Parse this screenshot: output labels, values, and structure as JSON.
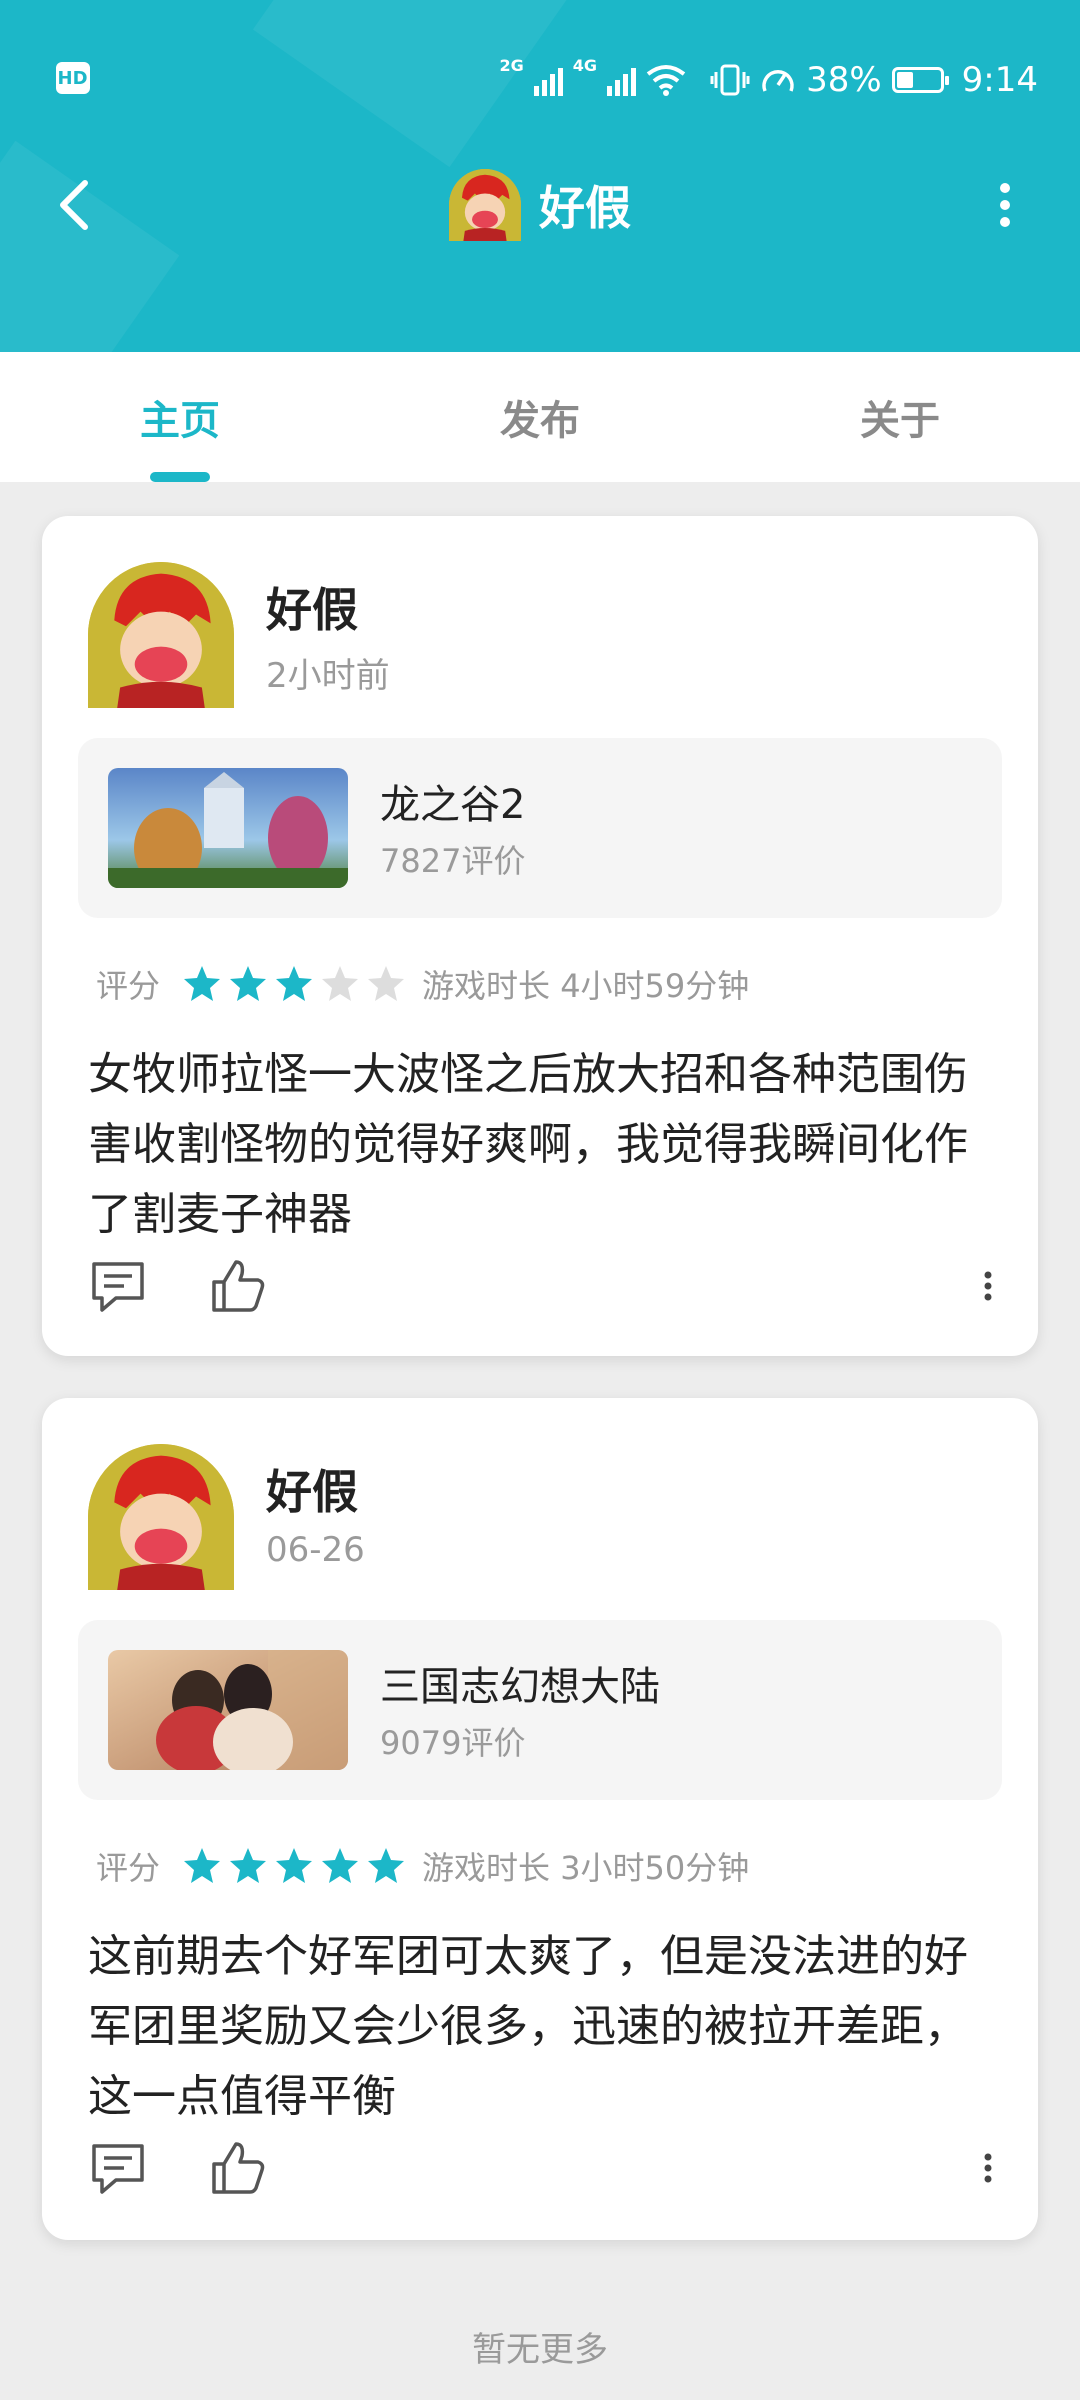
{
  "status_bar": {
    "hd": "HD",
    "net1": "2G",
    "net2": "4G",
    "battery_percent": "38%",
    "battery_level": 0.38,
    "time": "9:14"
  },
  "nav": {
    "title": "好假"
  },
  "tabs": [
    {
      "label": "主页",
      "active": true
    },
    {
      "label": "发布",
      "active": false
    },
    {
      "label": "关于",
      "active": false
    }
  ],
  "posts": [
    {
      "user": "好假",
      "time": "2小时前",
      "game": {
        "name": "龙之谷2",
        "reviews": "7827评价"
      },
      "rating_label": "评分",
      "stars": 3,
      "playtime": "游戏时长 4小时59分钟",
      "review": "女牧师拉怪一大波怪之后放大招和各种范围伤害收割怪物的觉得好爽啊，我觉得我瞬间化作了割麦子神器"
    },
    {
      "user": "好假",
      "time": "06-26",
      "game": {
        "name": "三国志幻想大陆",
        "reviews": "9079评价"
      },
      "rating_label": "评分",
      "stars": 5,
      "playtime": "游戏时长 3小时50分钟",
      "review": "这前期去个好军团可太爽了，但是没法进的好军团里奖励又会少很多，迅速的被拉开差距，这一点值得平衡"
    }
  ],
  "footer": "暂无更多",
  "colors": {
    "accent": "#1cb7c8",
    "star_empty": "#dddddd"
  }
}
